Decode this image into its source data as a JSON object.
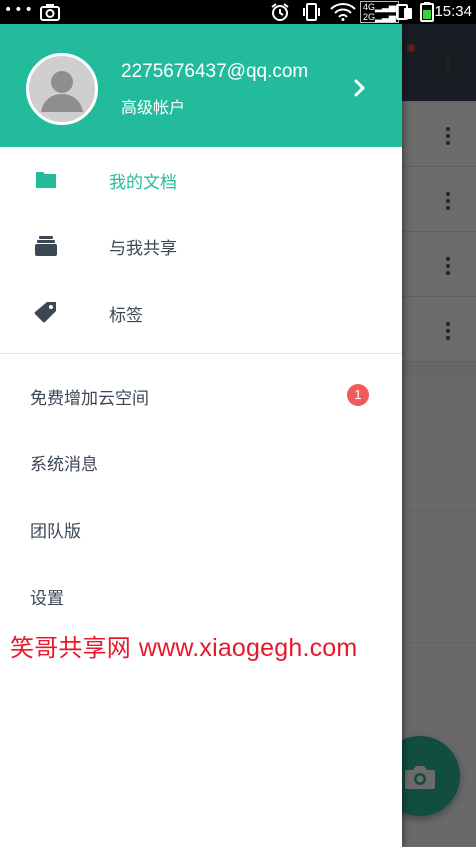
{
  "status_bar": {
    "dots": "•••",
    "time": "15:34",
    "network_type": "4G",
    "network_type_2": "2G"
  },
  "account": {
    "email": "2275676437@qq.com",
    "type": "高级帐户"
  },
  "nav": [
    {
      "label": "我的文档",
      "icon": "folder-icon",
      "active": true
    },
    {
      "label": "与我共享",
      "icon": "shared-stack-icon",
      "active": false
    },
    {
      "label": "标签",
      "icon": "tag-icon",
      "active": false
    }
  ],
  "menu": [
    {
      "label": "免费增加云空间",
      "badge": "1"
    },
    {
      "label": "系统消息"
    },
    {
      "label": "团队版"
    },
    {
      "label": "设置"
    }
  ],
  "watermark": {
    "name": "笑哥共享网",
    "url": "www.xiaogegh.com"
  },
  "colors": {
    "accent": "#22bc9c",
    "text": "#3c4756",
    "badge": "#f05a5a",
    "watermark": "#e8182c"
  }
}
